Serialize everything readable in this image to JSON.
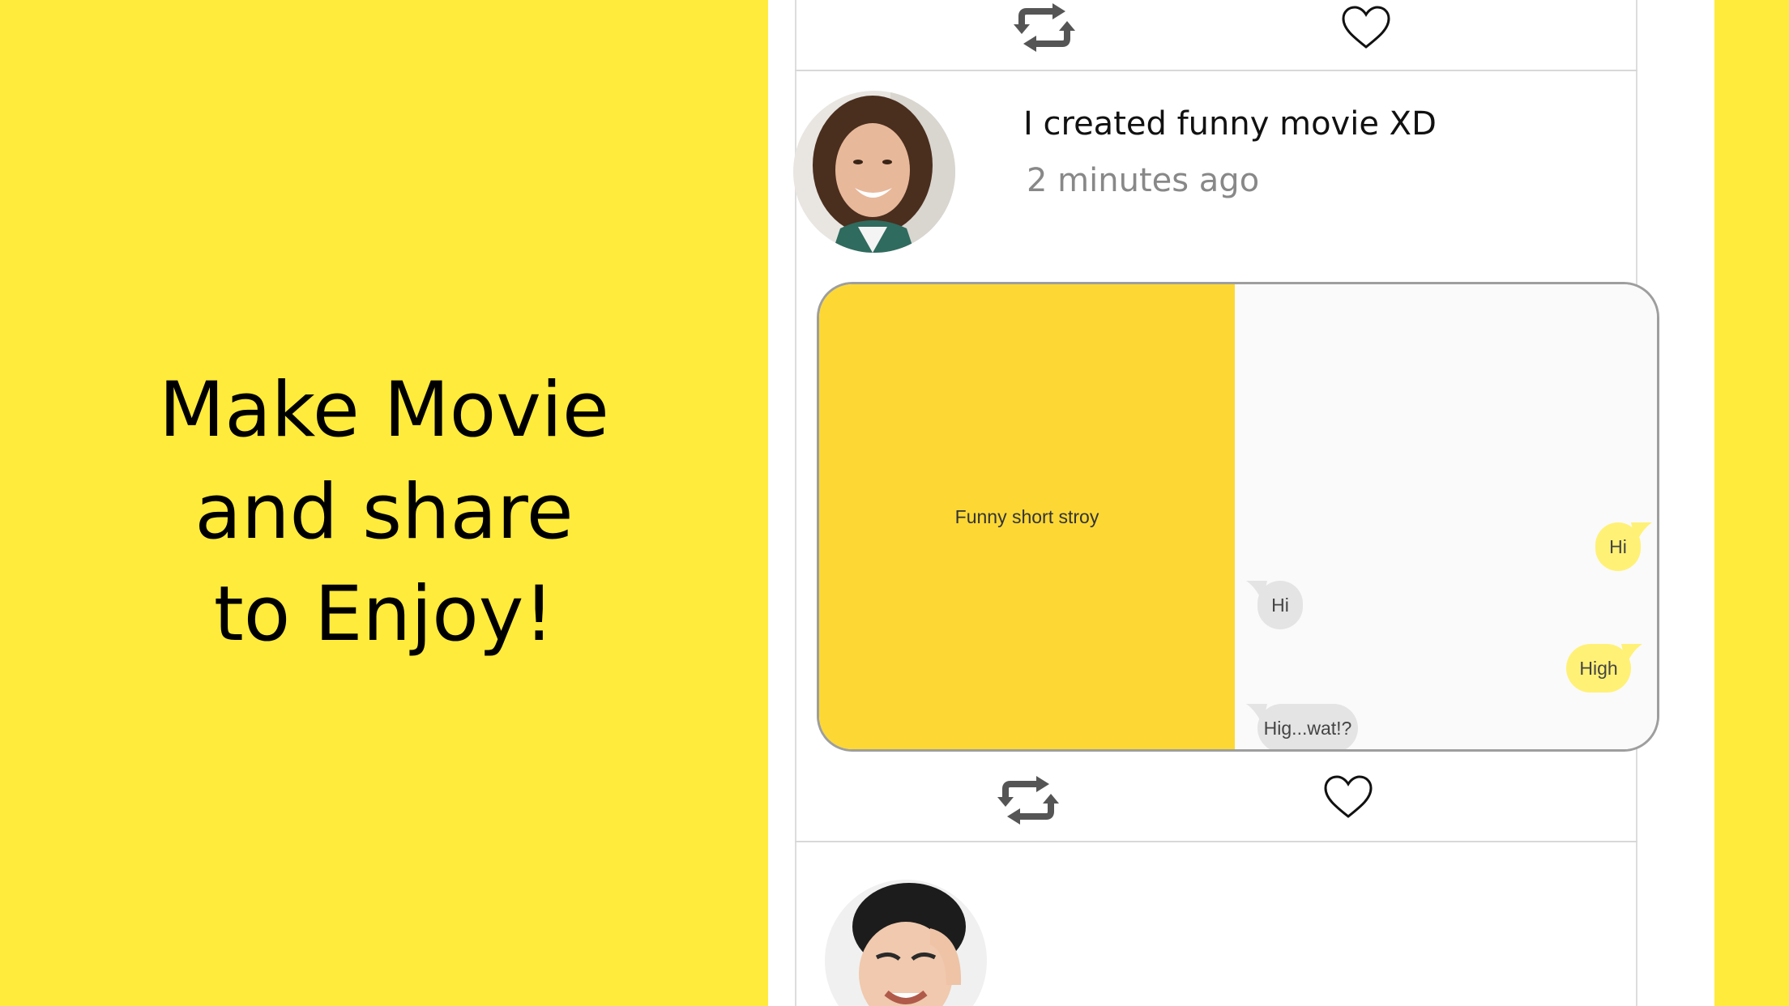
{
  "promo": {
    "line1": "Make Movie",
    "line2": "and share",
    "line3": "to Enjoy!"
  },
  "colors": {
    "brand_yellow": "#FFEB3B",
    "story_yellow": "#FDD835",
    "bubble_yellow": "#FFF176",
    "bubble_gray": "#e4e4e4",
    "muted_text": "#888888"
  },
  "feed": {
    "post": {
      "title": "I created funny movie XD",
      "time": "2 minutes ago",
      "movie": {
        "story_title": "Funny short stroy",
        "messages": [
          {
            "side": "right",
            "text": "Hi"
          },
          {
            "side": "left",
            "text": "Hi"
          },
          {
            "side": "right",
            "text": "High"
          },
          {
            "side": "left",
            "text": "Hig...wat!?"
          }
        ]
      }
    },
    "icons": {
      "repost": "repost-icon",
      "like": "heart-icon"
    }
  }
}
